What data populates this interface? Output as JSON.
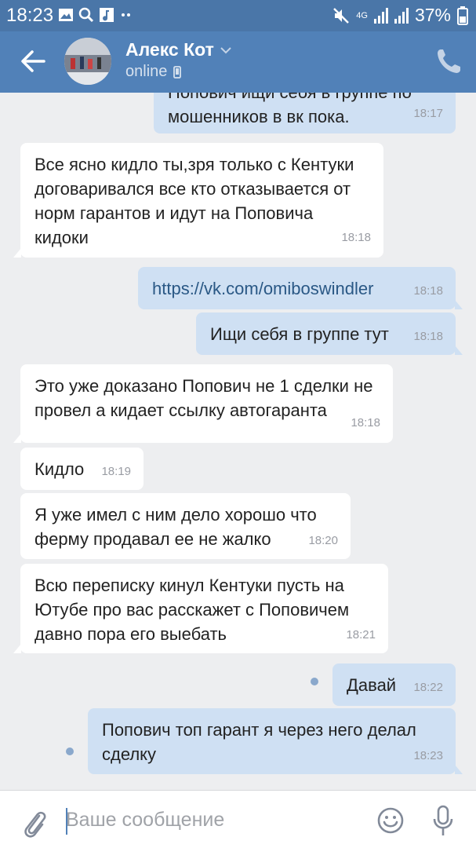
{
  "status_bar": {
    "time": "18:23",
    "network": "4G",
    "battery": "37%"
  },
  "header": {
    "contact_name": "Алекс Кот",
    "status": "online"
  },
  "messages": [
    {
      "dir": "out",
      "text": "Попович ищи себя в группе по мошенников в вк пока.",
      "time": "18:17"
    },
    {
      "dir": "in",
      "text": "Все ясно кидло ты,зря только с Кентуки договаривался все кто отказывается от норм гарантов и идут на Поповича кидоки",
      "time": "18:18"
    },
    {
      "dir": "out",
      "text": "https://vk.com/omiboswindler",
      "time": "18:18",
      "is_link": true
    },
    {
      "dir": "out",
      "text": "Ищи себя в группе тут",
      "time": "18:18"
    },
    {
      "dir": "in",
      "text": "Это уже доказано Попович не 1 сделки не провел а кидает ссылку автогаранта",
      "time": "18:18"
    },
    {
      "dir": "in",
      "text": "Кидло",
      "time": "18:19"
    },
    {
      "dir": "in",
      "text": "Я уже имел с ним дело хорошо что ферму продавал ее не жалко",
      "time": "18:20"
    },
    {
      "dir": "in",
      "text": "Всю переписку кинул Кентуки пусть на Ютубе про вас расскажет с Поповичем давно пора его выебать",
      "time": "18:21"
    },
    {
      "dir": "out",
      "text": "Давай",
      "time": "18:22",
      "unread": true
    },
    {
      "dir": "out",
      "text": "Попович топ гарант я через него делал сделку",
      "time": "18:23",
      "unread": true
    }
  ],
  "composer": {
    "placeholder": "Ваше сообщение"
  },
  "colors": {
    "header": "#5181b8",
    "statusbar": "#4a76a8",
    "background": "#edeef0",
    "outgoing_bubble": "#cfe0f3",
    "incoming_bubble": "#ffffff",
    "link": "#2a5885"
  }
}
